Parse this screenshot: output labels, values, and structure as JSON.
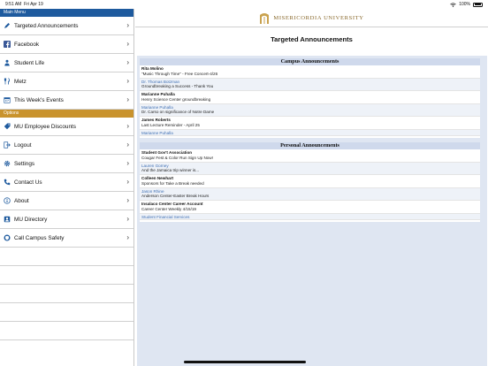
{
  "status_bar": {
    "time": "9:51 AM",
    "date": "Fri Apr 19",
    "battery": "100%"
  },
  "sidebar": {
    "main_header": "Main Menu",
    "options_header": "Options",
    "main_items": [
      {
        "label": "Targeted Announcements",
        "icon": "pencil-icon"
      },
      {
        "label": "Facebook",
        "icon": "facebook-icon"
      },
      {
        "label": "Student Life",
        "icon": "person-icon"
      },
      {
        "label": "Metz",
        "icon": "utensils-icon"
      },
      {
        "label": "This Week's Events",
        "icon": "calendar-icon"
      }
    ],
    "option_items": [
      {
        "label": "MU Employee Discounts",
        "icon": "tag-icon"
      },
      {
        "label": "Logout",
        "icon": "logout-icon"
      },
      {
        "label": "Settings",
        "icon": "gear-icon"
      },
      {
        "label": "Contact Us",
        "icon": "phone-icon"
      },
      {
        "label": "About",
        "icon": "info-icon"
      },
      {
        "label": "MU Directory",
        "icon": "directory-icon"
      },
      {
        "label": "Call Campus Safety",
        "icon": "shield-icon"
      }
    ]
  },
  "header": {
    "logo_text": "MISERICORDIA UNIVERSITY"
  },
  "main": {
    "title": "Targeted Announcements",
    "campus": {
      "heading": "Campus Announcements",
      "items": [
        {
          "from": "Rita Molino",
          "subject": "\"Music Through Time\" - Free Concert-4/26",
          "link": false
        },
        {
          "from": "Dr. Thomas Botzman",
          "subject": "Groundbreaking a Success - Thank You",
          "link": true
        },
        {
          "from": "Marianne Puhalla",
          "subject": "Henry Science Center groundbreaking",
          "link": false
        },
        {
          "from": "Marianne Puhalla",
          "subject": "Dr. Carso on significance of Notre Dame",
          "link": true
        },
        {
          "from": "James Roberts",
          "subject": "Last Lecture Reminder - April 25",
          "link": false
        },
        {
          "from": "Marianne Puhalla",
          "subject": "",
          "link": true
        }
      ]
    },
    "personal": {
      "heading": "Personal Announcements",
      "items": [
        {
          "from": "Student Gov't Association",
          "subject": "Cougar Fest & Color Run Sign Up Now!",
          "link": false
        },
        {
          "from": "Lauren Gorney",
          "subject": "And the Jamaica trip winner is...",
          "link": true
        },
        {
          "from": "Colleen Newhart",
          "subject": "Sponsors for Take a Break needed",
          "link": false
        },
        {
          "from": "Jason Rhine",
          "subject": "Anderson Center-Easter Break Hours",
          "link": true
        },
        {
          "from": "Insalaco Center Career Account",
          "subject": "Career Center Weekly 4/15/19",
          "link": false
        },
        {
          "from": "Student Financial Services",
          "subject": "",
          "link": true
        }
      ]
    }
  }
}
